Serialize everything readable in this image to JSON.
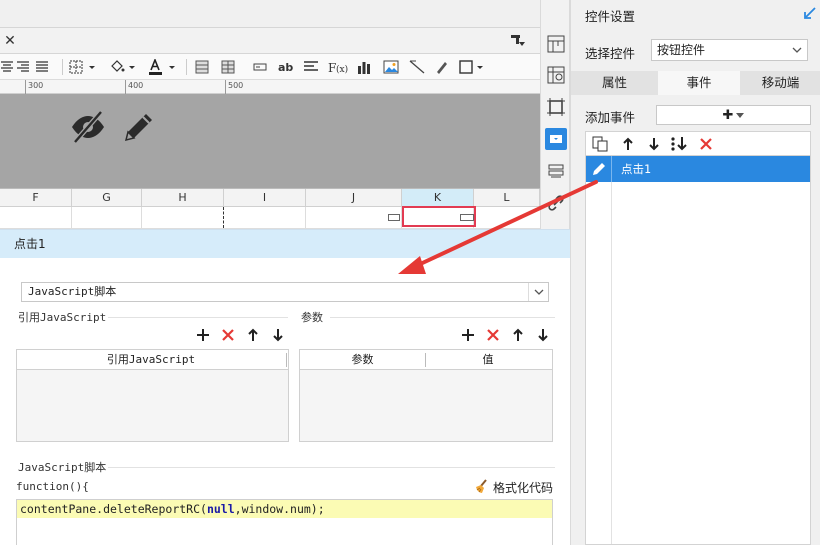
{
  "tab_bar": {
    "close_glyph": "✕"
  },
  "ruler": {
    "ticks": [
      "300",
      "400",
      "500"
    ]
  },
  "columns": [
    "F",
    "G",
    "H",
    "I",
    "J",
    "K",
    "L"
  ],
  "dialog": {
    "title": "点击1",
    "script_type": "JavaScript脚本",
    "ref_section_label": "引用JavaScript",
    "params_section_label": "参数",
    "ref_table_header": "引用JavaScript",
    "params_table_headers": [
      "参数",
      "值"
    ],
    "script_section_label": "JavaScript脚本",
    "function_header": "function(){",
    "format_code_label": "格式化代码",
    "code": {
      "prefix": "contentPane.deleteReportRC(",
      "arg1": "null",
      "middle": ",window.num);"
    }
  },
  "right_panel": {
    "title": "控件设置",
    "select_control_label": "选择控件",
    "select_control_value": "按钮控件",
    "tabs": [
      "属性",
      "事件",
      "移动端"
    ],
    "active_tab": "事件",
    "add_event_label": "添加事件",
    "add_event_glyph": "✚",
    "events": [
      {
        "label": "点击1",
        "selected": true
      }
    ]
  },
  "colors": {
    "accent": "#2a88e0",
    "dialog_header": "#d6ecfa",
    "delete_red": "#e53935",
    "selection_border": "#e23b52",
    "annotation_arrow": "#e53935",
    "code_highlight": "#fbfbb4",
    "canvas_gray": "#a5a5a5"
  },
  "icons": [
    "close-icon",
    "tab-menu-icon",
    "hide-eye-icon",
    "edit-pencil-icon",
    "pin-arrow-icon",
    "copy-icon",
    "move-up-icon",
    "move-down-icon",
    "move-bottom-icon",
    "delete-icon",
    "add-icon",
    "broom-icon",
    "dropdown-chevron-icon"
  ]
}
